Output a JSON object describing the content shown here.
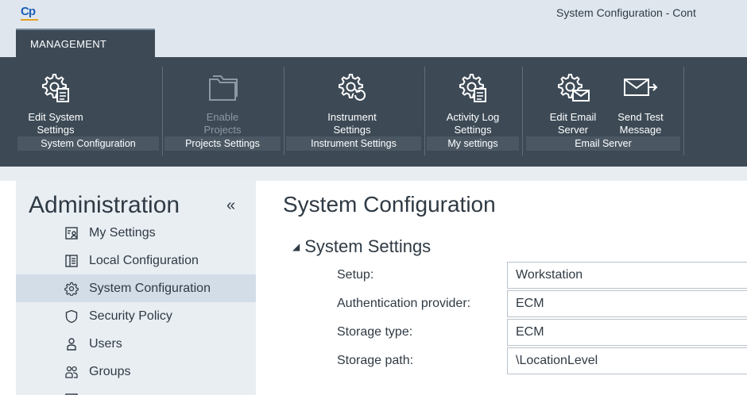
{
  "window": {
    "title": "System Configuration - Cont"
  },
  "tabs": [
    {
      "label": "MANAGEMENT"
    }
  ],
  "ribbon": {
    "groups": [
      {
        "label": "System Configuration",
        "buttons": [
          {
            "label": "Edit System\nSettings",
            "icon": "gear-document-icon"
          }
        ]
      },
      {
        "label": "Projects Settings",
        "buttons": [
          {
            "label": "Enable\nProjects",
            "icon": "folder-icon",
            "disabled": true
          }
        ]
      },
      {
        "label": "Instrument Settings",
        "buttons": [
          {
            "label": "Instrument\nSettings",
            "icon": "gear-refresh-icon"
          }
        ]
      },
      {
        "label": "My settings",
        "buttons": [
          {
            "label": "Activity Log\nSettings",
            "icon": "gear-document-icon"
          }
        ]
      },
      {
        "label": "Email Server",
        "buttons": [
          {
            "label": "Edit Email\nServer",
            "icon": "gear-envelope-icon"
          },
          {
            "label": "Send Test\nMessage",
            "icon": "envelope-send-icon"
          }
        ]
      }
    ]
  },
  "sidebar": {
    "title": "Administration",
    "collapse_glyph": "«",
    "items": [
      {
        "label": "My Settings",
        "icon": "user-card-icon",
        "active": false
      },
      {
        "label": "Local Configuration",
        "icon": "panel-icon",
        "active": false
      },
      {
        "label": "System Configuration",
        "icon": "gear-icon",
        "active": true
      },
      {
        "label": "Security Policy",
        "icon": "shield-icon",
        "active": false
      },
      {
        "label": "Users",
        "icon": "user-icon",
        "active": false
      },
      {
        "label": "Groups",
        "icon": "group-icon",
        "active": false
      }
    ]
  },
  "main": {
    "title": "System Configuration",
    "section": {
      "title": "System Settings",
      "rows": [
        {
          "label": "Setup:",
          "value": "Workstation"
        },
        {
          "label": "Authentication provider:",
          "value": "ECM"
        },
        {
          "label": "Storage type:",
          "value": "ECM"
        },
        {
          "label": "Storage path:",
          "value": "\\LocationLevel"
        }
      ]
    }
  }
}
